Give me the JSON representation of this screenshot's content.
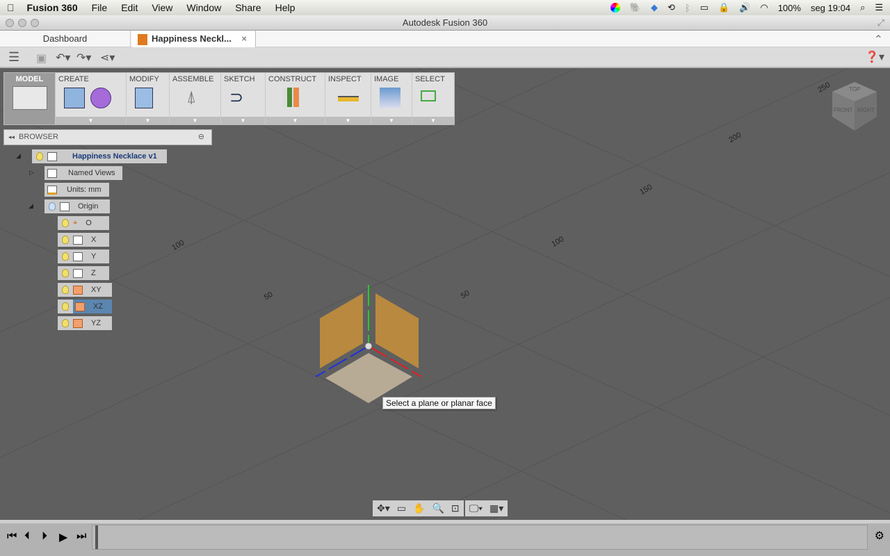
{
  "menubar": {
    "app": "Fusion 360",
    "items": [
      "File",
      "Edit",
      "View",
      "Window",
      "Share",
      "Help"
    ],
    "battery": "100%",
    "clock": "seg 19:04"
  },
  "window": {
    "title": "Autodesk Fusion 360"
  },
  "tabs": [
    {
      "label": "Dashboard"
    },
    {
      "label": "Happiness Neckl...",
      "active": true
    }
  ],
  "ribbon": {
    "workspace": "MODEL",
    "groups": [
      "CREATE",
      "MODIFY",
      "ASSEMBLE",
      "SKETCH",
      "CONSTRUCT",
      "INSPECT",
      "IMAGE",
      "SELECT"
    ]
  },
  "browser": {
    "title": "BROWSER",
    "root": "Happiness Necklace v1",
    "named_views": "Named Views",
    "units": "Units: mm",
    "origin": "Origin",
    "origin_items": [
      {
        "label": "O"
      },
      {
        "label": "X"
      },
      {
        "label": "Y"
      },
      {
        "label": "Z"
      },
      {
        "label": "XY"
      },
      {
        "label": "XZ",
        "selected": true
      },
      {
        "label": "YZ"
      }
    ]
  },
  "viewcube": {
    "top": "TOP",
    "front": "FRONT",
    "right": "RIGHT"
  },
  "grid_labels": [
    "250",
    "200",
    "150",
    "100",
    "50",
    "100",
    "50"
  ],
  "tooltip": "Select a plane or planar face",
  "colors": {
    "viewport": "#5f5f5f",
    "selection": "#5b86b0",
    "plane": "#c8913a"
  }
}
